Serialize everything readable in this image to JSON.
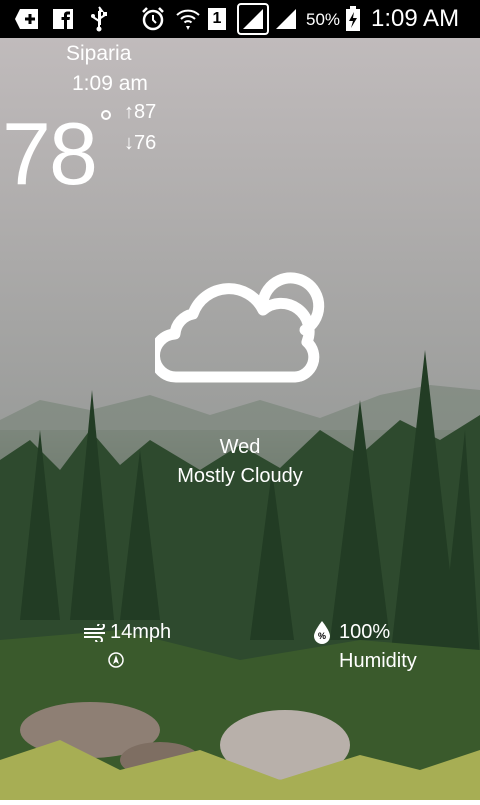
{
  "status_bar": {
    "icons": [
      "add-icon",
      "facebook-icon",
      "usb-icon",
      "alarm-icon",
      "wifi-icon",
      "sim-1-icon",
      "signal-icon",
      "signal-icon",
      "battery-charging-icon"
    ],
    "sim_slot": "1",
    "battery_percent": "50%",
    "time": "1:09 AM"
  },
  "weather": {
    "city": "Siparia",
    "time": "1:09 am",
    "temperature": "78",
    "high": "↑87",
    "low": "↓76",
    "condition_icon": "cloud-icon",
    "day": "Wed",
    "condition": "Mostly Cloudy",
    "wind": "14mph",
    "humidity": "100%",
    "humidity_label": "Humidity"
  }
}
